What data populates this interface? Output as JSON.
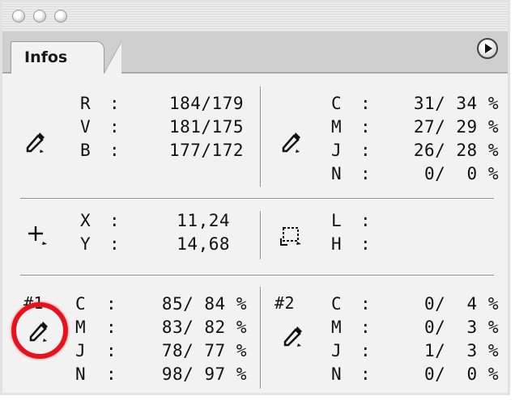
{
  "tab": {
    "label": "Infos"
  },
  "sections": {
    "rvb": {
      "labels": [
        "R",
        "V",
        "B"
      ],
      "values": [
        "184/179",
        "181/175",
        "177/172"
      ]
    },
    "cmjn": {
      "labels": [
        "C",
        "M",
        "J",
        "N"
      ],
      "values": [
        "31/ 34 %",
        "27/ 29 %",
        "26/ 28 %",
        "0/  0 %"
      ]
    },
    "position": {
      "labels": [
        "X",
        "Y"
      ],
      "values": [
        "11,24",
        "14,68"
      ]
    },
    "size": {
      "labels": [
        "L",
        "H"
      ]
    },
    "sampler1": {
      "id": "#1",
      "labels": [
        "C",
        "M",
        "J",
        "N"
      ],
      "values": [
        "85/ 84 %",
        "83/ 82 %",
        "78/ 77 %",
        "98/ 97 %"
      ]
    },
    "sampler2": {
      "id": "#2",
      "labels": [
        "C",
        "M",
        "J",
        "N"
      ],
      "values": [
        "0/  4 %",
        "0/  3 %",
        "1/  3 %",
        "0/  0 %"
      ]
    }
  },
  "separator": ":",
  "colors": {
    "highlight": "#e8121c"
  }
}
